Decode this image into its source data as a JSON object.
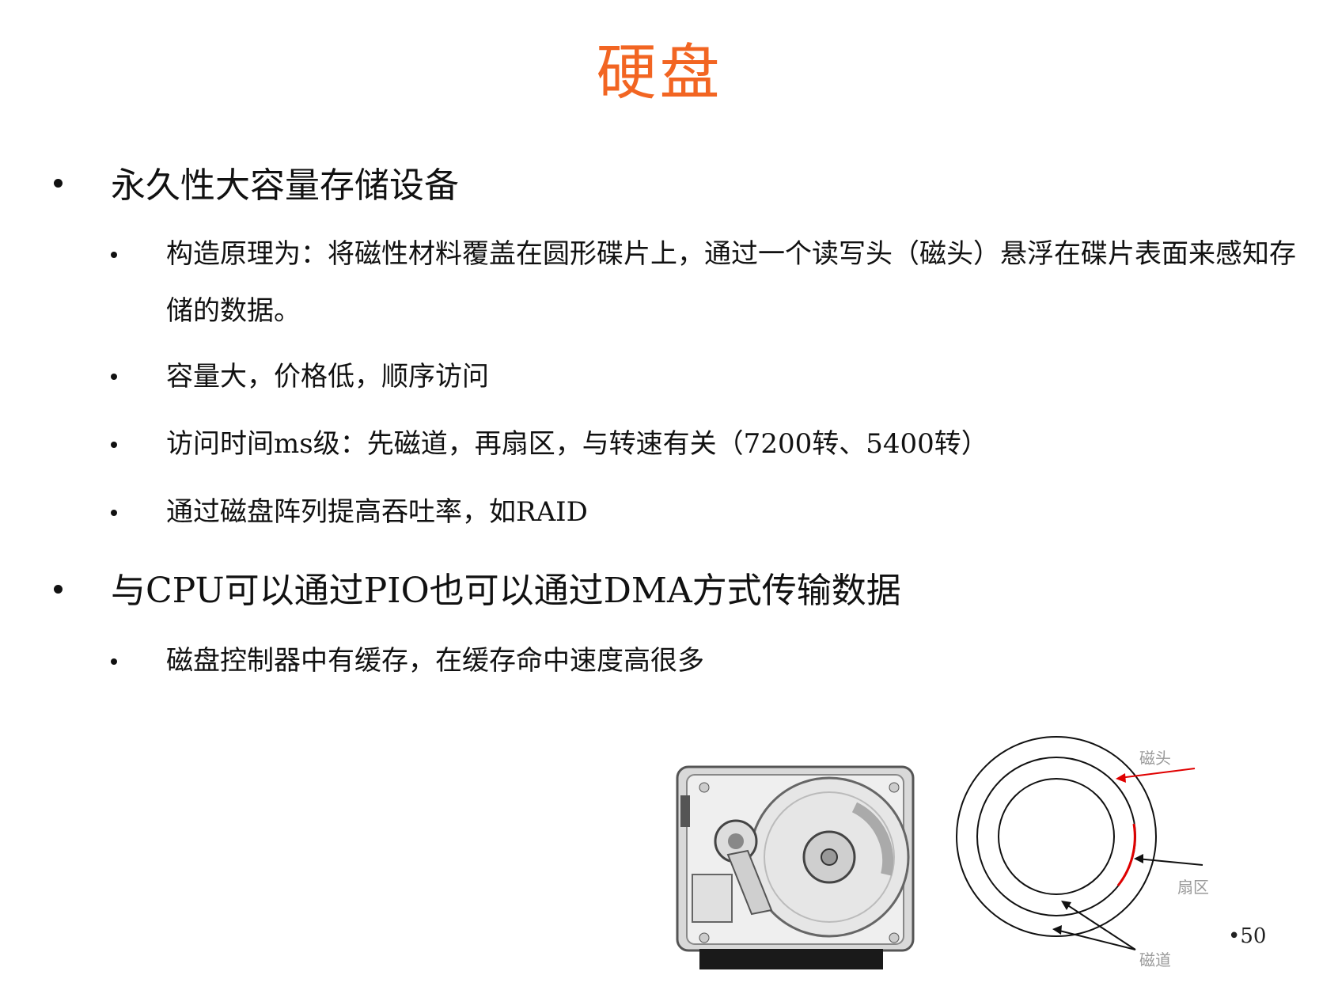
{
  "slide": {
    "title": "硬盘",
    "page_number": "•50",
    "items": [
      {
        "level": 1,
        "text": "永久性大容量存储设备"
      },
      {
        "level": 2,
        "text": "构造原理为：将磁性材料覆盖在圆形碟片上，通过一个读写头（磁头）悬浮在碟片表面来感知存储的数据。"
      },
      {
        "level": 2,
        "text": "容量大，价格低，顺序访问"
      },
      {
        "level": 2,
        "text": "访问时间ms级：先磁道，再扇区，与转速有关（7200转、5400转）"
      },
      {
        "level": 2,
        "text": "通过磁盘阵列提高吞吐率，如RAID"
      },
      {
        "level": 1,
        "text": "与CPU可以通过PIO也可以通过DMA方式传输数据"
      },
      {
        "level": 2,
        "text": "磁盘控制器中有缓存，在缓存命中速度高很多"
      }
    ],
    "diagram": {
      "label_head": "磁头",
      "label_sector": "扇区",
      "label_track": "磁道",
      "accent_color": "#e00000"
    },
    "colors": {
      "title": "#f26522",
      "text": "#111111"
    }
  }
}
